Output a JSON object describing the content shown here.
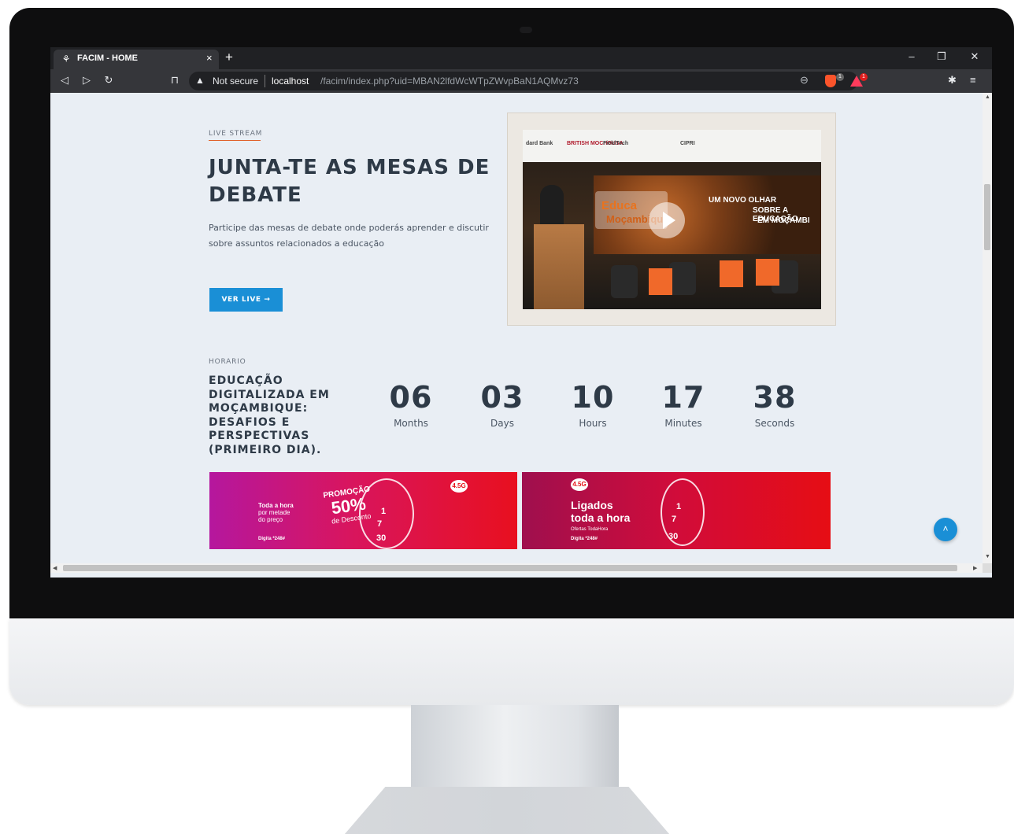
{
  "browser": {
    "tab_title": "FACIM - HOME",
    "new_tab": "+",
    "close_tab": "×",
    "security_label": "Not secure",
    "url_host": "localhost",
    "url_path": "/facim/index.php?uid=MBAN2lfdWcWTpZWvpBaN1AQMvz73",
    "brave_badge": "1",
    "rewards_badge": "1"
  },
  "live": {
    "eyebrow": "LIVE STREAM",
    "headline": "JUNTA-TE AS MESAS DE DEBATE",
    "lead": "Participe das mesas de debate onde poderás aprender e discutir sobre assuntos relacionados a educação",
    "button": "VER LIVE →",
    "video": {
      "sponsors": [
        "dard Bank",
        "BRITISH MOCHOUSA",
        "FieldTech",
        "CIPRI"
      ],
      "stage_text_1": "UM NOVO OLHAR",
      "stage_text_2": "SOBRE A EDUCAÇÃO",
      "stage_text_3": "EM MOÇAMBI",
      "logo_text": "Educa",
      "logo_sub": "Moçambique"
    }
  },
  "schedule": {
    "eyebrow": "HORARIO",
    "title": "EDUCAÇÃO DIGITALIZADA EM MOÇAMBIQUE: DESAFIOS E PERSPECTIVAS (PRIMEIRO DIA).",
    "countdown": [
      {
        "value": "06",
        "label": "Months"
      },
      {
        "value": "03",
        "label": "Days"
      },
      {
        "value": "10",
        "label": "Hours"
      },
      {
        "value": "17",
        "label": "Minutes"
      },
      {
        "value": "38",
        "label": "Seconds"
      }
    ]
  },
  "banners": {
    "left": {
      "line1": "Toda a hora",
      "line2": "por metade",
      "line3": "do preço",
      "promo_title": "PROMOÇÃO",
      "promo_value": "50%",
      "promo_sub": "de Desconto",
      "dial": "Digita *248#",
      "badge": "4.5G",
      "price_a": "1",
      "price_b": "7",
      "price_c": "30"
    },
    "right": {
      "badge": "4.5G",
      "headline_1": "Ligados",
      "headline_2": "toda a hora",
      "sub": "Ofertas TodaHora",
      "dial": "Digita *248#",
      "price_a": "1",
      "price_b": "7",
      "price_c": "30"
    }
  },
  "colors": {
    "accent": "#1a8fd6",
    "heading": "#2e3a47",
    "page_bg": "#e9eef4",
    "eyebrow_line": "#e0612a"
  }
}
